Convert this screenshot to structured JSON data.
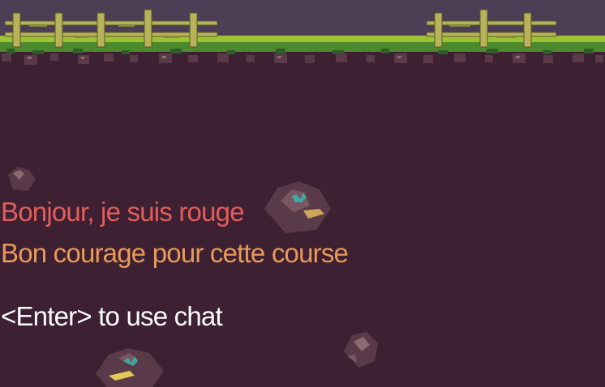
{
  "scene": {
    "palette": {
      "background": "#3d2031",
      "sky": "#4c3e55",
      "grass": "#9cc233",
      "grass_dark": "#4d8a2e",
      "fence": "#b6b35a",
      "rock": "#5a3a48"
    },
    "decor": [
      "wooden-fence",
      "grass-strip",
      "dirt-rocks",
      "crystal-rocks"
    ]
  },
  "chat": {
    "messages": [
      {
        "text": "Bonjour, je suis rouge",
        "color": "#e35d5d"
      },
      {
        "text": "Bon courage pour cette course",
        "color": "#e89a58"
      }
    ],
    "hint": {
      "text": "<Enter> to use chat",
      "color": "#ffffff"
    }
  }
}
